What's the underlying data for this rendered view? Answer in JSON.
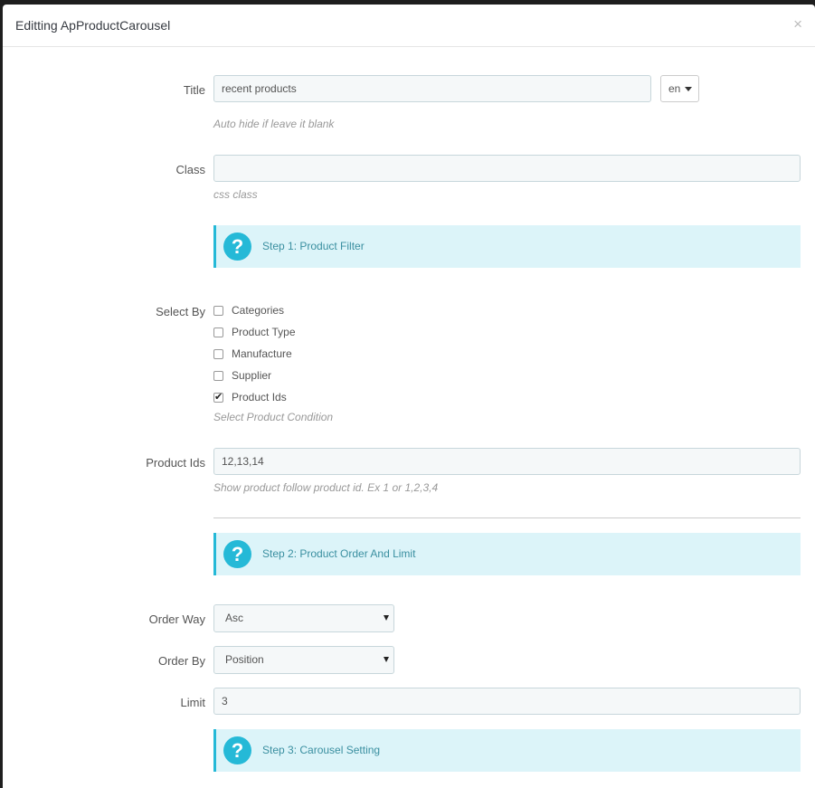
{
  "modal": {
    "title": "Editting ApProductCarousel",
    "close_label": "×"
  },
  "form": {
    "title_label": "Title",
    "title_value": "recent products",
    "lang_value": "en",
    "title_help": "Auto hide if leave it blank",
    "class_label": "Class",
    "class_value": "",
    "class_help": "css class",
    "step1": "Step 1: Product Filter",
    "select_by_label": "Select By",
    "select_by_options": [
      {
        "label": "Categories",
        "checked": false
      },
      {
        "label": "Product Type",
        "checked": false
      },
      {
        "label": "Manufacture",
        "checked": false
      },
      {
        "label": "Supplier",
        "checked": false
      },
      {
        "label": "Product Ids",
        "checked": true
      }
    ],
    "select_by_help": "Select Product Condition",
    "product_ids_label": "Product Ids",
    "product_ids_value": "12,13,14",
    "product_ids_help": "Show product follow product id. Ex 1 or 1,2,3,4",
    "step2": "Step 2: Product Order And Limit",
    "order_way_label": "Order Way",
    "order_way_value": "Asc",
    "order_by_label": "Order By",
    "order_by_value": "Position",
    "limit_label": "Limit",
    "limit_value": "3",
    "step3": "Step 3: Carousel Setting",
    "help_icon_glyph": "?"
  },
  "colors": {
    "accent": "#25b9d7",
    "alert_bg": "#dcf4f9",
    "input_bg": "#f5f8f9"
  }
}
